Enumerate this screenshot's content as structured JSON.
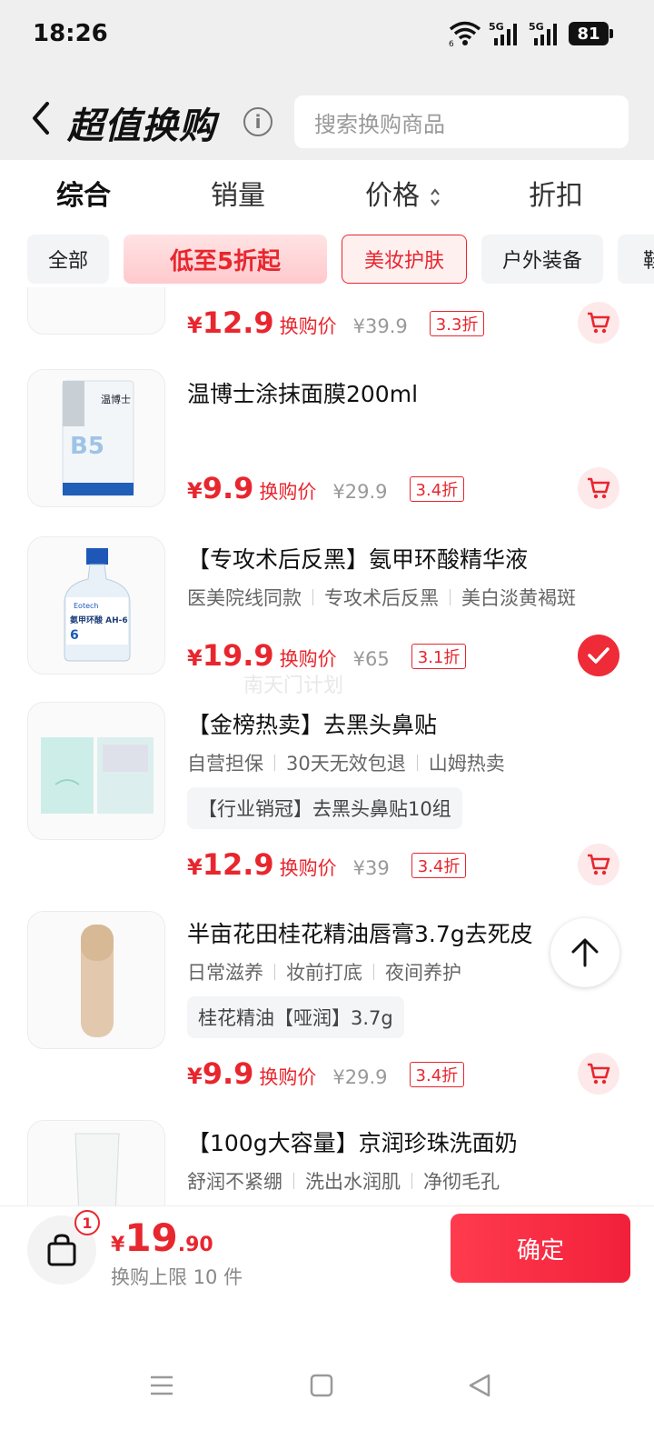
{
  "status": {
    "time": "18:26",
    "battery": "81",
    "net1": "5G",
    "net2": "5G",
    "wifi_sub": "6"
  },
  "header": {
    "title": "超值换购",
    "search_placeholder": "搜索换购商品"
  },
  "sort_tabs": [
    {
      "label": "综合",
      "active": true
    },
    {
      "label": "销量",
      "active": false
    },
    {
      "label": "价格",
      "active": false
    },
    {
      "label": "折扣",
      "active": false
    }
  ],
  "chips": [
    {
      "label": "全部"
    },
    {
      "label": "低至5折起"
    },
    {
      "label": "美妆护肤",
      "selected": true
    },
    {
      "label": "户外装备"
    },
    {
      "label": "鞋"
    }
  ],
  "products": [
    {
      "name": "",
      "price": "12.9",
      "price_label": "换购价",
      "orig": "¥39.9",
      "discount": "3.3折",
      "selected": false
    },
    {
      "name": "温博士涂抹面膜200ml",
      "price": "9.9",
      "price_label": "换购价",
      "orig": "¥29.9",
      "discount": "3.4折",
      "selected": false
    },
    {
      "name": "【专攻术后反黑】氨甲环酸精华液",
      "tags": [
        "医美院线同款",
        "专攻术后反黑",
        "美白淡黄褐斑"
      ],
      "price": "19.9",
      "price_label": "换购价",
      "orig": "¥65",
      "discount": "3.1折",
      "selected": true
    },
    {
      "name": "【金榜热卖】去黑头鼻贴",
      "tags": [
        "自营担保",
        "30天无效包退",
        "山姆热卖"
      ],
      "spec": "【行业销冠】去黑头鼻贴10组",
      "price": "12.9",
      "price_label": "换购价",
      "orig": "¥39",
      "discount": "3.4折",
      "selected": false
    },
    {
      "name": "半亩花田桂花精油唇膏3.7g去死皮",
      "tags": [
        "日常滋养",
        "妆前打底",
        "夜间养护"
      ],
      "spec": "桂花精油【哑润】3.7g",
      "price": "9.9",
      "price_label": "换购价",
      "orig": "¥29.9",
      "discount": "3.4折",
      "selected": false
    },
    {
      "name": "【100g大容量】京润珍珠洗面奶",
      "tags": [
        "舒润不紧绷",
        "洗出水润肌",
        "净彻毛孔"
      ]
    }
  ],
  "thumb_text": {
    "p1_brand": "温博士",
    "p1_mark": "B5",
    "p2_brand": "Eotech",
    "p2_label": "氨甲环酸 AH-6",
    "p2_num": "6"
  },
  "watermark": "南天门计划",
  "currency": "¥",
  "footer": {
    "badge": "1",
    "currency": "¥",
    "total_int": "19",
    "total_dec": ".90",
    "limit": "换购上限 10 件",
    "confirm": "确定"
  },
  "colors": {
    "accent": "#e8262e",
    "confirm_start": "#ff3b4e",
    "confirm_end": "#f2203a"
  }
}
